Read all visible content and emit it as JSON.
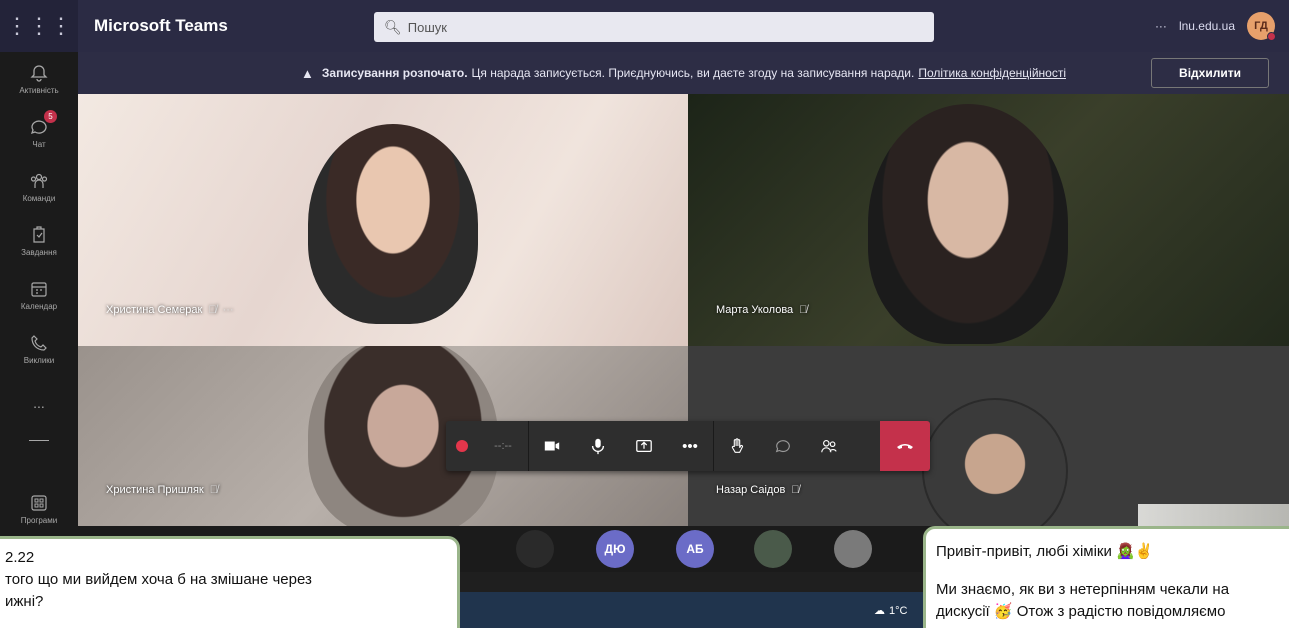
{
  "app": {
    "title": "Microsoft Teams",
    "apps_icon": "grid-icon"
  },
  "search": {
    "placeholder": "Пошук"
  },
  "account": {
    "more": "···",
    "domain": "lnu.edu.ua",
    "initials": "ГД"
  },
  "rail": [
    {
      "label": "Активність",
      "icon": "bell-icon"
    },
    {
      "label": "Чат",
      "icon": "chat-icon",
      "badge": "5"
    },
    {
      "label": "Команди",
      "icon": "teams-icon"
    },
    {
      "label": "Завдання",
      "icon": "assignments-icon"
    },
    {
      "label": "Календар",
      "icon": "calendar-icon"
    },
    {
      "label": "Виклики",
      "icon": "phone-icon"
    },
    {
      "label": "...",
      "icon": "more-icon"
    },
    {
      "label": "Програми",
      "icon": "apps-icon"
    }
  ],
  "banner": {
    "bold": "Записування розпочато.",
    "text": "Ця нарада записується. Приєднуючись, ви даєте згоду на записування наради.",
    "link": "Політика конфіденційності",
    "decline": "Відхилити"
  },
  "participants": [
    {
      "name": "Христина Семерак"
    },
    {
      "name": "Марта Уколова"
    },
    {
      "name": "Христина Пришляк"
    },
    {
      "name": "Назар Саідов"
    }
  ],
  "controls": {
    "timer": "--:--"
  },
  "strip": [
    {
      "label": "",
      "color": "#2a2a2a"
    },
    {
      "label": "ДЮ",
      "color": "#6b6cc7"
    },
    {
      "label": "АБ",
      "color": "#6b6cc7"
    },
    {
      "label": "",
      "color": "#4a5a4a"
    },
    {
      "label": "",
      "color": "#7a7a7a"
    }
  ],
  "weather": {
    "temp": "1°C"
  },
  "chat_left": {
    "line1": "2.22",
    "line2": "того що ми вийдем хоча б на змішане через",
    "line3": "ижні?"
  },
  "chat_right": {
    "line1": "Привіт-привіт, любі хіміки 🧟‍♀️✌",
    "line2": "Ми знаємо, як ви з нетерпінням чекали на",
    "line3": "дискусії 🥳 Отож з радістю повідомляємо"
  },
  "colors": {
    "accent": "#c4314b",
    "header": "#2b2b44",
    "rail": "#1b1b1b"
  }
}
